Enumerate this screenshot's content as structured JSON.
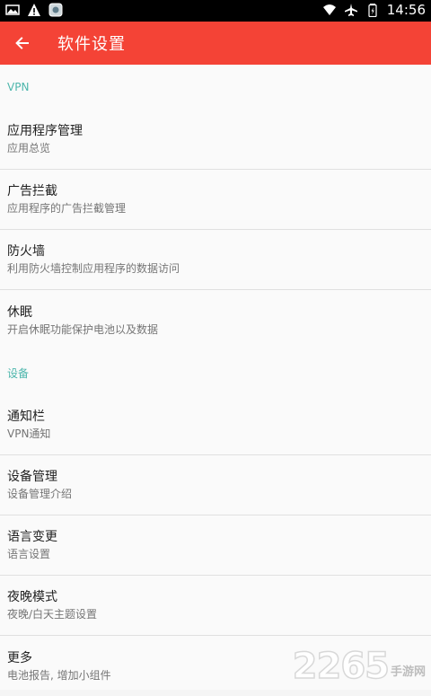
{
  "status_bar": {
    "time": "14:56",
    "icons": [
      "image-icon",
      "warning-icon",
      "app-icon",
      "wifi-icon",
      "airplane-icon",
      "battery-icon"
    ]
  },
  "app_bar": {
    "title": "软件设置",
    "color": "#f44336"
  },
  "sections": [
    {
      "header": "VPN",
      "items": [
        {
          "title": "应用程序管理",
          "subtitle": "应用总览"
        },
        {
          "title": "广告拦截",
          "subtitle": "应用程序的广告拦截管理"
        },
        {
          "title": "防火墙",
          "subtitle": "利用防火墙控制应用程序的数据访问"
        },
        {
          "title": "休眠",
          "subtitle": "开启休眠功能保护电池以及数据"
        }
      ]
    },
    {
      "header": "设备",
      "items": [
        {
          "title": "通知栏",
          "subtitle": "VPN通知"
        },
        {
          "title": "设备管理",
          "subtitle": "设备管理介绍"
        },
        {
          "title": "语言变更",
          "subtitle": "语言设置"
        },
        {
          "title": "夜晚模式",
          "subtitle": "夜晚/白天主题设置"
        },
        {
          "title": "更多",
          "subtitle": "电池报告, 增加小组件"
        }
      ]
    }
  ],
  "watermark": {
    "number": "2265",
    "text": "手游网"
  },
  "colors": {
    "accent": "#f44336",
    "section_header": "#4db6ac"
  }
}
